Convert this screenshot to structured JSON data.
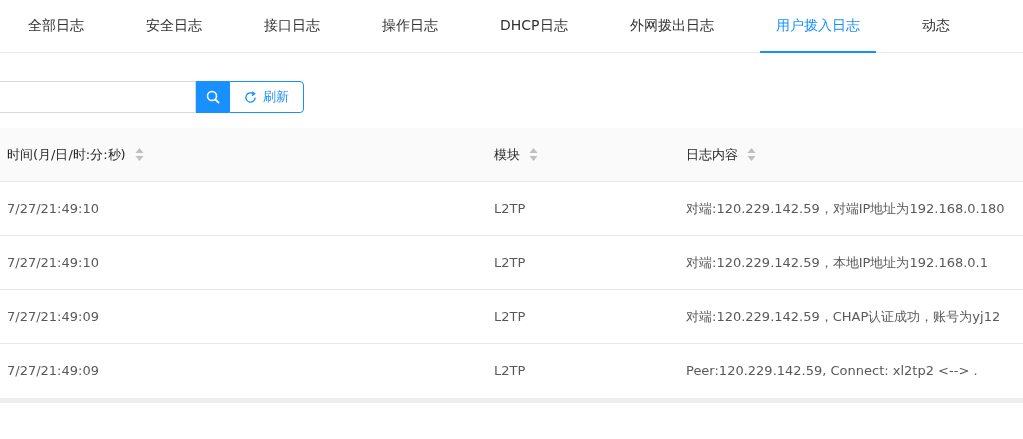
{
  "tabs": [
    {
      "label": "全部日志",
      "selected": false
    },
    {
      "label": "安全日志",
      "selected": false
    },
    {
      "label": "接口日志",
      "selected": false
    },
    {
      "label": "操作日志",
      "selected": false
    },
    {
      "label": "DHCP日志",
      "selected": false
    },
    {
      "label": "外网拨出日志",
      "selected": false
    },
    {
      "label": "用户拨入日志",
      "selected": true
    },
    {
      "label": "动态",
      "selected": false
    }
  ],
  "toolbar": {
    "refresh_button": "刷新"
  },
  "table": {
    "columns": [
      "时间(月/日/时:分:秒)",
      "模块",
      "日志内容"
    ],
    "rows": [
      [
        "7/27/21:49:10",
        "L2TP",
        "对端:120.229.142.59，对端IP地址为192.168.0.180"
      ],
      [
        "7/27/21:49:10",
        "L2TP",
        "对端:120.229.142.59，本地IP地址为192.168.0.1"
      ],
      [
        "7/27/21:49:09",
        "L2TP",
        "对端:120.229.142.59，CHAP认证成功，账号为yj12"
      ],
      [
        "7/27/21:49:09",
        "L2TP",
        "Peer:120.229.142.59, Connect: xl2tp2 <--> ."
      ]
    ]
  }
}
